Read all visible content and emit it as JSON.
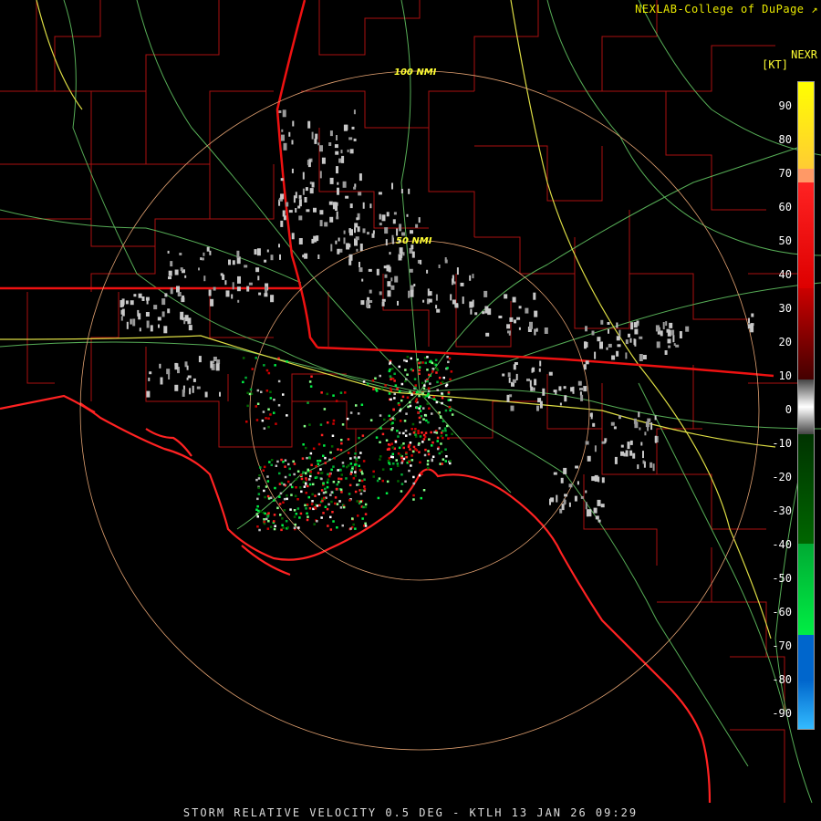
{
  "header": {
    "credit": "NEXLAB-College of DuPage",
    "product_code": "NEXR",
    "units": "[KT]"
  },
  "rings": [
    {
      "label": "100 NMI"
    },
    {
      "label": "50 NMI"
    }
  ],
  "colorbar": {
    "labels": [
      "90",
      "80",
      "70",
      "60",
      "50",
      "40",
      "30",
      "20",
      "10",
      "0",
      "-10",
      "-20",
      "-30",
      "-40",
      "-50",
      "-60",
      "-70",
      "-80",
      "-90"
    ],
    "colors": {
      "positive_high": "#ffff00",
      "positive_mid": "#ff9966",
      "positive": "#ff0000",
      "positive_low": "#660000",
      "range_folded": "#aaaaaa",
      "negative_low": "#006600",
      "negative": "#00cc33",
      "negative_high": "#0066cc",
      "negative_extreme": "#33aaff"
    }
  },
  "colors": {
    "background": "#000000",
    "county_lines": "#aa1111",
    "state_lines": "#ee1111",
    "coastline": "#ff2222",
    "highways": "#66cc66",
    "interstates": "#dddd44",
    "range_rings": "#e0a070"
  },
  "footer": {
    "caption": "STORM RELATIVE VELOCITY 0.5 DEG - KTLH 13 JAN 26 09:29"
  }
}
